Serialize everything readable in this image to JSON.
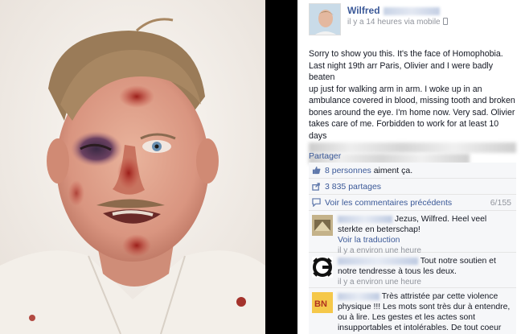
{
  "post": {
    "author": "Wilfred",
    "meta": "il y a 14 heures via mobile",
    "text_lines": [
      "Sorry to show you this. It's the face of Homophobia.",
      "Last night 19th arr Paris, Olivier and I were badly beaten",
      "up just for walking arm in arm. I woke up in an",
      "ambulance covered in blood, missing tooth and broken",
      "bones around the eye. I'm home now. Very sad. Olivier",
      "takes care of me. Forbidden to work for at least 10 days"
    ],
    "share_label": "Partager"
  },
  "ufi": {
    "likes_count": "8 personnes",
    "likes_suffix": " aiment ça.",
    "shares": "3 835 partages",
    "previous_comments": "Voir les commentaires précédents",
    "comment_count": "6/155"
  },
  "comments": [
    {
      "text": " Jezus, Wilfred. Heel veel sterkte en beterschap!",
      "translate": "Voir la traduction",
      "time": "il y a environ une heure"
    },
    {
      "text": " Tout notre soutien et notre tendresse à tous les deux.",
      "time": "il y a environ une heure"
    },
    {
      "text": " Très attristée par cette violence physique !!! Les mots sont très dur à entendre, ou à lire. Les gestes et les actes sont insupportables et intolérables. De tout coeur avec vous.",
      "time": ""
    }
  ],
  "icons": {
    "like": "thumbs-up-icon",
    "share": "share-icon",
    "comment": "speech-bubble-icon",
    "mobile": "mobile-phone-icon"
  },
  "colors": {
    "link": "#3b5998",
    "muted": "#90949c",
    "ufi_bg": "#f6f7f9"
  }
}
